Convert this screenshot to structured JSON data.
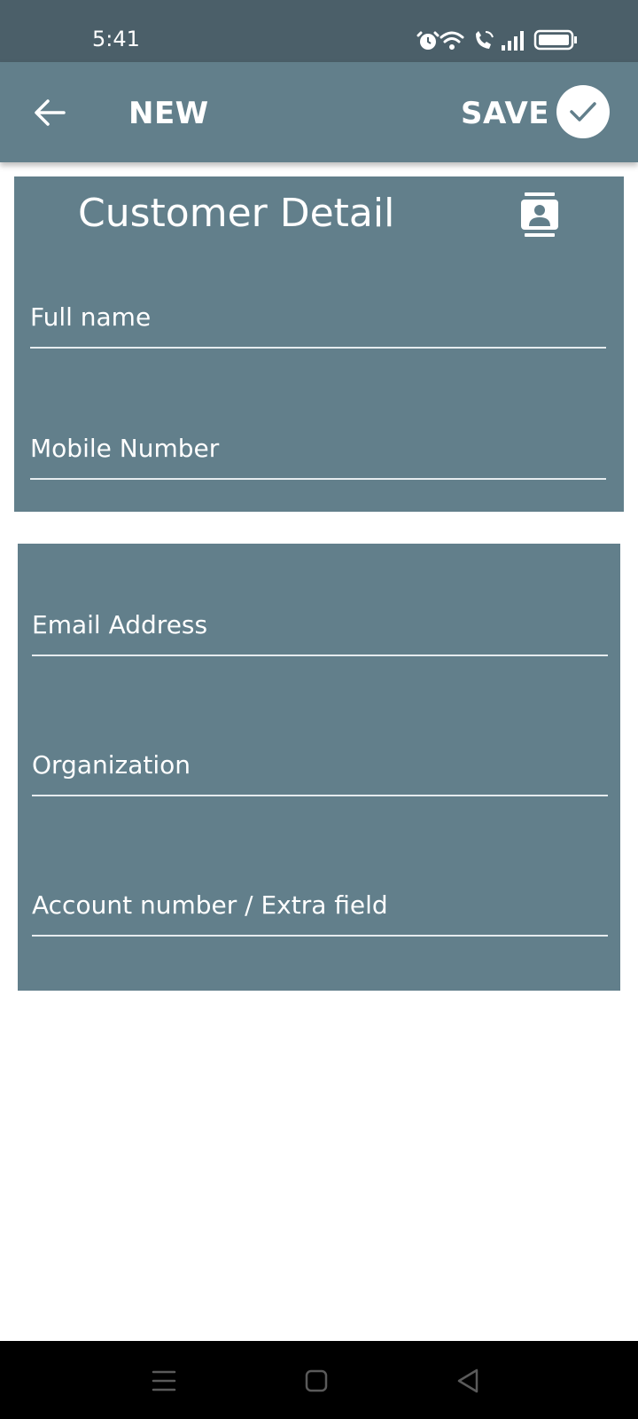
{
  "status_bar": {
    "time": "5:41",
    "icons": [
      "alarm-icon",
      "wifi-icon",
      "wifi-call-icon",
      "signal-icon",
      "battery-icon"
    ]
  },
  "app_bar": {
    "back_icon": "arrow-left-icon",
    "title": "NEW",
    "save_label": "SAVE",
    "save_icon": "check-circle-icon"
  },
  "customer_card": {
    "title": "Customer Detail",
    "icon": "contact-card-icon",
    "fields": {
      "full_name": {
        "value": "",
        "placeholder": "Full name"
      },
      "mobile_number": {
        "value": "",
        "placeholder": "Mobile Number"
      }
    }
  },
  "details_card": {
    "fields": {
      "email_address": {
        "value": "",
        "placeholder": "Email Address"
      },
      "organization": {
        "value": "",
        "placeholder": "Organization"
      },
      "account_number": {
        "value": "",
        "placeholder": "Account number / Extra field"
      }
    }
  },
  "nav_bar": {
    "buttons": [
      "menu-icon",
      "home-icon",
      "back-triangle-icon"
    ]
  },
  "colors": {
    "status_bar": "#4b5f69",
    "app_bar": "#627f8b",
    "card": "#627f8b",
    "underline": "#e6ecef",
    "nav_bar": "#000000"
  }
}
